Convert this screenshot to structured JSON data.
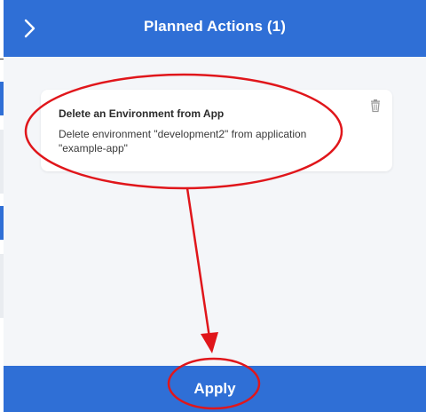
{
  "panel": {
    "title": "Planned Actions (1)",
    "collapse_icon": "chevron-right-icon"
  },
  "actions": [
    {
      "title": "Delete an Environment from App",
      "description": "Delete environment \"development2\" from application \"example-app\"",
      "delete_icon": "trash-icon"
    }
  ],
  "footer": {
    "apply_label": "Apply"
  },
  "colors": {
    "header_blue": "#2f6fd6",
    "panel_bg": "#f4f6f9",
    "card_bg": "#ffffff",
    "annotation_red": "#e0161b"
  }
}
